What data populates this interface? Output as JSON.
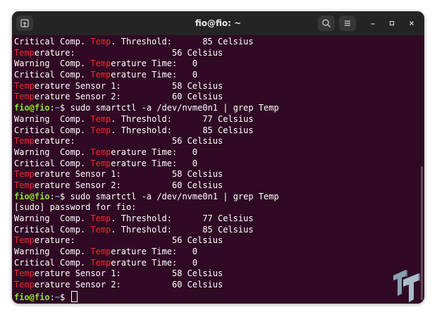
{
  "window": {
    "title": "fio@fio: ~",
    "colors": {
      "background": "#300a24",
      "titlebar": "#242424",
      "highlight": "#ef2929",
      "prompt_user": "#8ae234",
      "prompt_path": "#729fcf"
    },
    "icons": {
      "new_tab": "new-tab-icon",
      "search": "search-icon",
      "menu": "hamburger-menu-icon",
      "minimize": "minimize-icon",
      "maximize": "maximize-icon",
      "close": "close-icon"
    }
  },
  "terminal": {
    "prompt": {
      "user": "fio@fio",
      "sep": ":",
      "path": "~",
      "sign": "$ "
    },
    "lines": [
      {
        "type": "out",
        "pre": "Critical Comp. ",
        "hl": "Temp",
        "post": ". Threshold:      85 Celsius"
      },
      {
        "type": "out",
        "pre": "",
        "hl": "Temp",
        "post": "erature:                   56 Celsius"
      },
      {
        "type": "out",
        "pre": "Warning  Comp. ",
        "hl": "Temp",
        "post": "erature Time:   0"
      },
      {
        "type": "out",
        "pre": "Critical Comp. ",
        "hl": "Temp",
        "post": "erature Time:   0"
      },
      {
        "type": "out",
        "pre": "",
        "hl": "Temp",
        "post": "erature Sensor 1:          58 Celsius"
      },
      {
        "type": "out",
        "pre": "",
        "hl": "Temp",
        "post": "erature Sensor 2:          60 Celsius"
      },
      {
        "type": "cmd",
        "cmd": "sudo smartctl -a /dev/nvme0n1 | grep Temp"
      },
      {
        "type": "out",
        "pre": "Warning  Comp. ",
        "hl": "Temp",
        "post": ". Threshold:      77 Celsius"
      },
      {
        "type": "out",
        "pre": "Critical Comp. ",
        "hl": "Temp",
        "post": ". Threshold:      85 Celsius"
      },
      {
        "type": "out",
        "pre": "",
        "hl": "Temp",
        "post": "erature:                   56 Celsius"
      },
      {
        "type": "out",
        "pre": "Warning  Comp. ",
        "hl": "Temp",
        "post": "erature Time:   0"
      },
      {
        "type": "out",
        "pre": "Critical Comp. ",
        "hl": "Temp",
        "post": "erature Time:   0"
      },
      {
        "type": "out",
        "pre": "",
        "hl": "Temp",
        "post": "erature Sensor 1:          58 Celsius"
      },
      {
        "type": "out",
        "pre": "",
        "hl": "Temp",
        "post": "erature Sensor 2:          60 Celsius"
      },
      {
        "type": "cmd",
        "cmd": "sudo smartctl -a /dev/nvme0n1 | grep Temp"
      },
      {
        "type": "out",
        "pre": "[sudo] password for fio:",
        "hl": "",
        "post": ""
      },
      {
        "type": "out",
        "pre": "Warning  Comp. ",
        "hl": "Temp",
        "post": ". Threshold:      77 Celsius"
      },
      {
        "type": "out",
        "pre": "Critical Comp. ",
        "hl": "Temp",
        "post": ". Threshold:      85 Celsius"
      },
      {
        "type": "out",
        "pre": "",
        "hl": "Temp",
        "post": "erature:                   56 Celsius"
      },
      {
        "type": "out",
        "pre": "Warning  Comp. ",
        "hl": "Temp",
        "post": "erature Time:   0"
      },
      {
        "type": "out",
        "pre": "Critical Comp. ",
        "hl": "Temp",
        "post": "erature Time:   0"
      },
      {
        "type": "out",
        "pre": "",
        "hl": "Temp",
        "post": "erature Sensor 1:          58 Celsius"
      },
      {
        "type": "out",
        "pre": "",
        "hl": "Temp",
        "post": "erature Sensor 2:          60 Celsius"
      },
      {
        "type": "cmd",
        "cmd": "",
        "cursor": true
      }
    ]
  },
  "watermark": {
    "icon": "tt-logo-icon"
  }
}
